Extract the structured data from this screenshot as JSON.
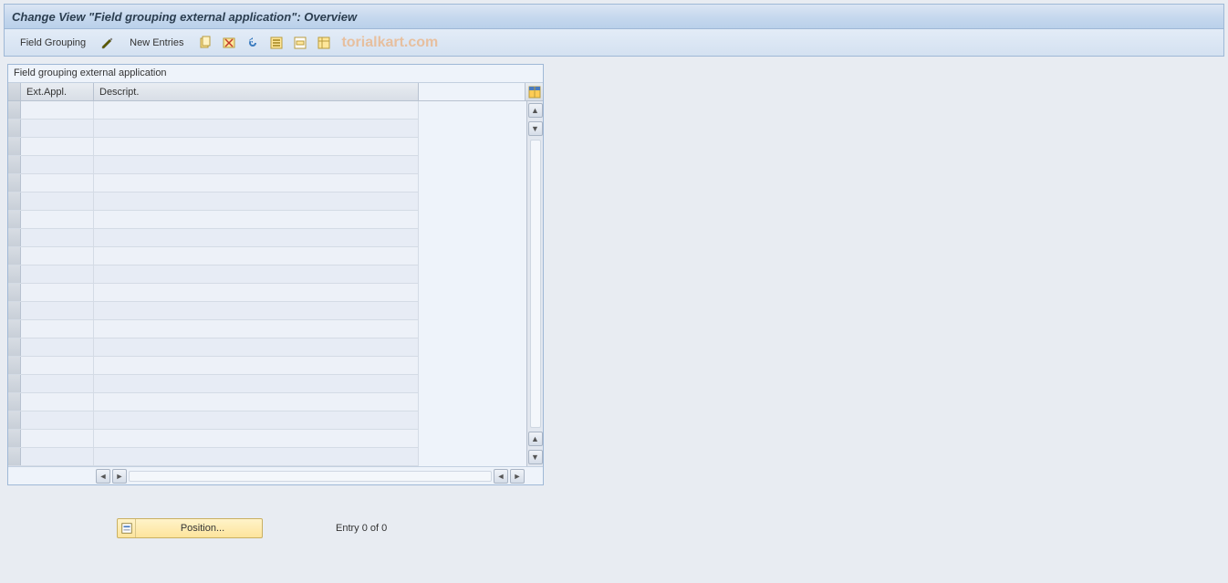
{
  "titlebar": {
    "title": "Change View \"Field grouping external application\": Overview"
  },
  "toolbar": {
    "field_grouping_label": "Field Grouping",
    "new_entries_label": "New Entries"
  },
  "watermark": "torialkart.com",
  "panel": {
    "title": "Field grouping external application",
    "columns": {
      "ext_appl": "Ext.Appl.",
      "descript": "Descript."
    },
    "rows": [
      {
        "ext": "",
        "desc": ""
      },
      {
        "ext": "",
        "desc": ""
      },
      {
        "ext": "",
        "desc": ""
      },
      {
        "ext": "",
        "desc": ""
      },
      {
        "ext": "",
        "desc": ""
      },
      {
        "ext": "",
        "desc": ""
      },
      {
        "ext": "",
        "desc": ""
      },
      {
        "ext": "",
        "desc": ""
      },
      {
        "ext": "",
        "desc": ""
      },
      {
        "ext": "",
        "desc": ""
      },
      {
        "ext": "",
        "desc": ""
      },
      {
        "ext": "",
        "desc": ""
      },
      {
        "ext": "",
        "desc": ""
      },
      {
        "ext": "",
        "desc": ""
      },
      {
        "ext": "",
        "desc": ""
      },
      {
        "ext": "",
        "desc": ""
      },
      {
        "ext": "",
        "desc": ""
      },
      {
        "ext": "",
        "desc": ""
      },
      {
        "ext": "",
        "desc": ""
      },
      {
        "ext": "",
        "desc": ""
      }
    ]
  },
  "footer": {
    "position_label": "Position...",
    "entry_status": "Entry 0 of 0"
  }
}
